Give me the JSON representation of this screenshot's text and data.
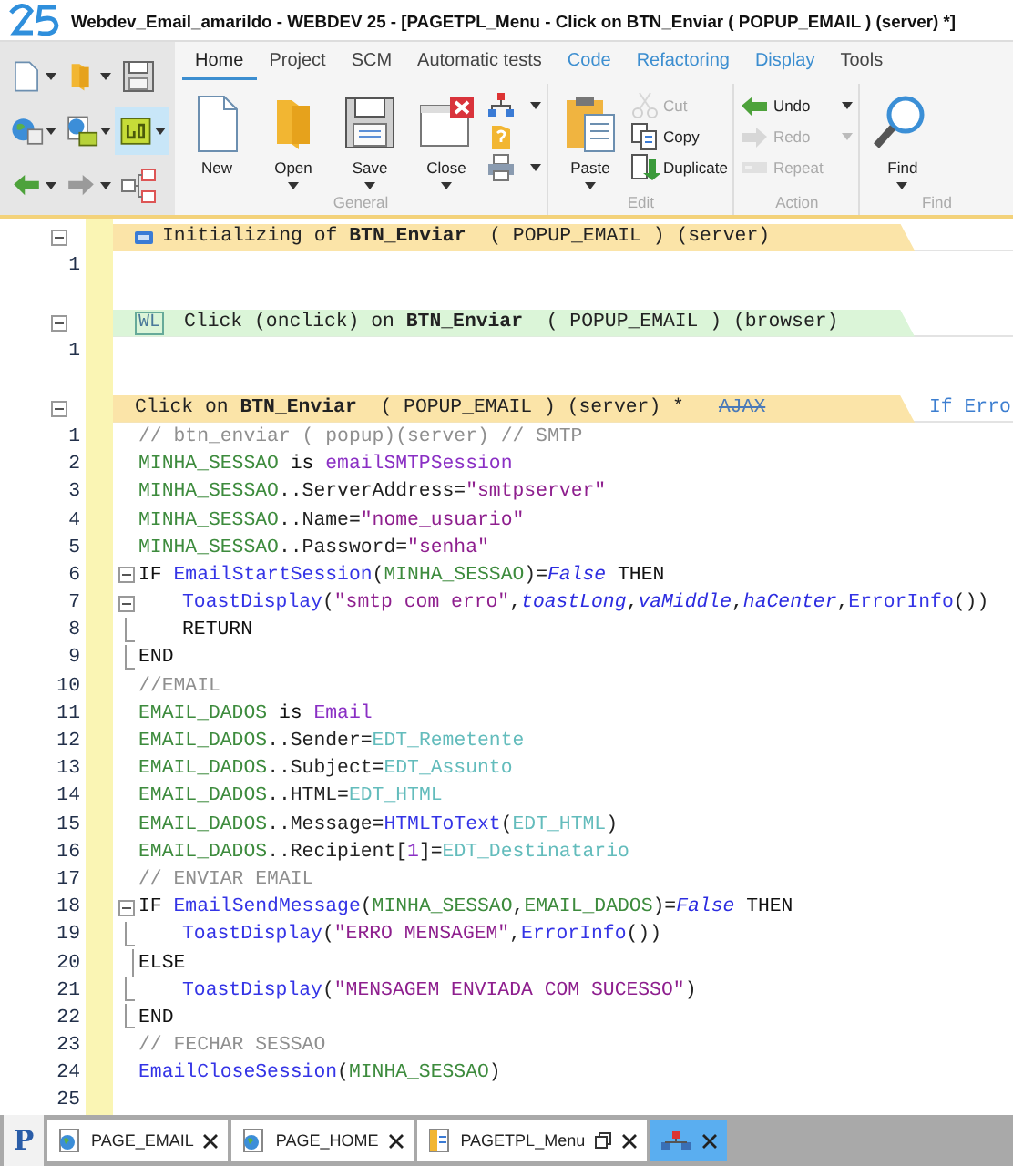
{
  "window": {
    "title": "Webdev_Email_amarildo - WEBDEV 25 - [PAGETPL_Menu - Click on BTN_Enviar ( POPUP_EMAIL ) (server) *]"
  },
  "quick_access": [
    {
      "dropdown": true,
      "highlighted": false
    },
    {
      "dropdown": true,
      "highlighted": false
    },
    {
      "dropdown": false,
      "highlighted": false
    },
    {
      "dropdown": true,
      "highlighted": false
    },
    {
      "dropdown": true,
      "highlighted": false
    },
    {
      "dropdown": true,
      "highlighted": true
    },
    {
      "dropdown": true,
      "highlighted": false
    },
    {
      "dropdown": true,
      "highlighted": false
    },
    {
      "dropdown": false,
      "highlighted": false
    }
  ],
  "ribbon": {
    "tabs": [
      {
        "label": "Home",
        "selected": true,
        "contextual": false
      },
      {
        "label": "Project",
        "selected": false,
        "contextual": false
      },
      {
        "label": "SCM",
        "selected": false,
        "contextual": false
      },
      {
        "label": "Automatic tests",
        "selected": false,
        "contextual": false
      },
      {
        "label": "Code",
        "selected": false,
        "contextual": true
      },
      {
        "label": "Refactoring",
        "selected": false,
        "contextual": true
      },
      {
        "label": "Display",
        "selected": false,
        "contextual": true
      },
      {
        "label": "Tools",
        "selected": false,
        "contextual": false
      }
    ],
    "groups": [
      {
        "label": "General",
        "buttons": [
          {
            "kind": "large",
            "label": "New",
            "disabled": false,
            "dropdown": false
          },
          {
            "kind": "large",
            "label": "Open",
            "disabled": false,
            "dropdown": true
          },
          {
            "kind": "large",
            "label": "Save",
            "disabled": false,
            "dropdown": true
          },
          {
            "kind": "large",
            "label": "Close",
            "disabled": false,
            "dropdown": true
          },
          {
            "kind": "small",
            "disabled": false,
            "dropdown": true
          },
          {
            "kind": "small",
            "disabled": false,
            "dropdown": false
          },
          {
            "kind": "small",
            "disabled": false,
            "dropdown": true
          }
        ]
      },
      {
        "label": "Edit",
        "buttons": [
          {
            "kind": "large",
            "label": "Paste",
            "disabled": false,
            "dropdown": true
          },
          {
            "kind": "small",
            "label": "Cut",
            "disabled": true,
            "dropdown": false
          },
          {
            "kind": "small",
            "label": "Copy",
            "disabled": false,
            "dropdown": false
          },
          {
            "kind": "small",
            "label": "Duplicate",
            "disabled": false,
            "dropdown": false
          }
        ]
      },
      {
        "label": "Action",
        "buttons": [
          {
            "kind": "small",
            "label": "Undo",
            "disabled": false,
            "dropdown": true
          },
          {
            "kind": "small",
            "label": "Redo",
            "disabled": true,
            "dropdown": true
          },
          {
            "kind": "small",
            "label": "Repeat",
            "disabled": true,
            "dropdown": false
          }
        ]
      },
      {
        "label": "Find",
        "buttons": [
          {
            "kind": "large",
            "label": "Find",
            "disabled": false,
            "dropdown": true
          }
        ]
      }
    ]
  },
  "editor": {
    "events": [
      {
        "kind": "init",
        "title": "Initializing of **BTN_Enviar**  ( POPUP_EMAIL ) (server)",
        "lines": [
          {
            "number": "1"
          }
        ]
      },
      {
        "kind": "browser",
        "badge": "WL",
        "title": "Click (onclick) on **BTN_Enviar**  ( POPUP_EMAIL ) (browser)",
        "lines": [
          {
            "number": "1"
          }
        ]
      },
      {
        "kind": "server",
        "title": "Click on **BTN_Enviar**  ( POPUP_EMAIL ) (server) *",
        "tag": "AJAX",
        "tag_enabled": false,
        "note": "If Erro",
        "lines": [
          {
            "number": "1",
            "kind": "plain",
            "nested": false,
            "tokens": [
              {
                "kind": "comment",
                "text": "// btn_enviar ( popup)(server) // SMTP"
              }
            ]
          },
          {
            "number": "2",
            "kind": "plain",
            "nested": false,
            "tokens": [
              {
                "kind": "variable",
                "text": "MINHA_SESSAO"
              },
              {
                "kind": "keyword",
                "text": " is "
              },
              {
                "kind": "type",
                "text": "emailSMTPSession"
              }
            ]
          },
          {
            "number": "3",
            "kind": "plain",
            "nested": false,
            "tokens": [
              {
                "kind": "variable",
                "text": "MINHA_SESSAO"
              },
              {
                "kind": "plain",
                "text": "..ServerAddress="
              },
              {
                "kind": "string",
                "text": "\"smtpserver\""
              }
            ]
          },
          {
            "number": "4",
            "kind": "plain",
            "nested": false,
            "tokens": [
              {
                "kind": "variable",
                "text": "MINHA_SESSAO"
              },
              {
                "kind": "plain",
                "text": "..Name="
              },
              {
                "kind": "string",
                "text": "\"nome_usuario\""
              }
            ]
          },
          {
            "number": "5",
            "kind": "plain",
            "nested": false,
            "tokens": [
              {
                "kind": "variable",
                "text": "MINHA_SESSAO"
              },
              {
                "kind": "plain",
                "text": "..Password="
              },
              {
                "kind": "string",
                "text": "\"senha\""
              }
            ]
          },
          {
            "number": "6",
            "kind": "fold_start",
            "nested": false,
            "tokens": [
              {
                "kind": "keyword",
                "text": "IF "
              },
              {
                "kind": "function",
                "text": "EmailStartSession"
              },
              {
                "kind": "plain",
                "text": "("
              },
              {
                "kind": "variable",
                "text": "MINHA_SESSAO"
              },
              {
                "kind": "plain",
                "text": ")="
              },
              {
                "kind": "constant",
                "text": "False"
              },
              {
                "kind": "keyword",
                "text": " THEN"
              }
            ]
          },
          {
            "number": "7",
            "kind": "fold_start",
            "nested": true,
            "tokens": [
              {
                "kind": "function",
                "text": "ToastDisplay"
              },
              {
                "kind": "plain",
                "text": "("
              },
              {
                "kind": "string",
                "text": "\"smtp com erro\""
              },
              {
                "kind": "plain",
                "text": ","
              },
              {
                "kind": "constant",
                "text": "toastLong"
              },
              {
                "kind": "plain",
                "text": ","
              },
              {
                "kind": "constant",
                "text": "vaMiddle"
              },
              {
                "kind": "plain",
                "text": ","
              },
              {
                "kind": "constant",
                "text": "haCenter"
              },
              {
                "kind": "plain",
                "text": ","
              },
              {
                "kind": "function",
                "text": "ErrorInfo"
              },
              {
                "kind": "plain",
                "text": "())"
              }
            ]
          },
          {
            "number": "8",
            "kind": "fold_end",
            "nested": true,
            "tokens": [
              {
                "kind": "keyword",
                "text": "RETURN"
              }
            ]
          },
          {
            "number": "9",
            "kind": "fold_end",
            "nested": false,
            "tokens": [
              {
                "kind": "keyword",
                "text": "END"
              }
            ]
          },
          {
            "number": "10",
            "kind": "plain",
            "nested": false,
            "tokens": [
              {
                "kind": "comment",
                "text": "//EMAIL"
              }
            ]
          },
          {
            "number": "11",
            "kind": "plain",
            "nested": false,
            "tokens": [
              {
                "kind": "variable",
                "text": "EMAIL_DADOS"
              },
              {
                "kind": "keyword",
                "text": " is "
              },
              {
                "kind": "type",
                "text": "Email"
              }
            ]
          },
          {
            "number": "12",
            "kind": "plain",
            "nested": false,
            "tokens": [
              {
                "kind": "variable",
                "text": "EMAIL_DADOS"
              },
              {
                "kind": "plain",
                "text": "..Sender="
              },
              {
                "kind": "control",
                "text": "EDT_Remetente"
              }
            ]
          },
          {
            "number": "13",
            "kind": "plain",
            "nested": false,
            "tokens": [
              {
                "kind": "variable",
                "text": "EMAIL_DADOS"
              },
              {
                "kind": "plain",
                "text": "..Subject="
              },
              {
                "kind": "control",
                "text": "EDT_Assunto"
              }
            ]
          },
          {
            "number": "14",
            "kind": "plain",
            "nested": false,
            "tokens": [
              {
                "kind": "variable",
                "text": "EMAIL_DADOS"
              },
              {
                "kind": "plain",
                "text": "..HTML="
              },
              {
                "kind": "control",
                "text": "EDT_HTML"
              }
            ]
          },
          {
            "number": "15",
            "kind": "plain",
            "nested": false,
            "tokens": [
              {
                "kind": "variable",
                "text": "EMAIL_DADOS"
              },
              {
                "kind": "plain",
                "text": "..Message="
              },
              {
                "kind": "function",
                "text": "HTMLToText"
              },
              {
                "kind": "plain",
                "text": "("
              },
              {
                "kind": "control",
                "text": "EDT_HTML"
              },
              {
                "kind": "plain",
                "text": ")"
              }
            ]
          },
          {
            "number": "16",
            "kind": "plain",
            "nested": false,
            "tokens": [
              {
                "kind": "variable",
                "text": "EMAIL_DADOS"
              },
              {
                "kind": "plain",
                "text": "..Recipient["
              },
              {
                "kind": "number",
                "text": "1"
              },
              {
                "kind": "plain",
                "text": "]="
              },
              {
                "kind": "control",
                "text": "EDT_Destinatario"
              }
            ]
          },
          {
            "number": "17",
            "kind": "plain",
            "nested": false,
            "tokens": [
              {
                "kind": "comment",
                "text": "// ENVIAR EMAIL"
              }
            ]
          },
          {
            "number": "18",
            "kind": "fold_start",
            "nested": false,
            "tokens": [
              {
                "kind": "keyword",
                "text": "IF "
              },
              {
                "kind": "function",
                "text": "EmailSendMessage"
              },
              {
                "kind": "plain",
                "text": "("
              },
              {
                "kind": "variable",
                "text": "MINHA_SESSAO"
              },
              {
                "kind": "plain",
                "text": ","
              },
              {
                "kind": "variable",
                "text": "EMAIL_DADOS"
              },
              {
                "kind": "plain",
                "text": ")="
              },
              {
                "kind": "constant",
                "text": "False"
              },
              {
                "kind": "keyword",
                "text": " THEN"
              }
            ]
          },
          {
            "number": "19",
            "kind": "fold_end",
            "nested": true,
            "tokens": [
              {
                "kind": "function",
                "text": "ToastDisplay"
              },
              {
                "kind": "plain",
                "text": "("
              },
              {
                "kind": "string",
                "text": "\"ERRO MENSAGEM\""
              },
              {
                "kind": "plain",
                "text": ","
              },
              {
                "kind": "function",
                "text": "ErrorInfo"
              },
              {
                "kind": "plain",
                "text": "())"
              }
            ]
          },
          {
            "number": "20",
            "kind": "fold_bar",
            "nested": false,
            "tokens": [
              {
                "kind": "keyword",
                "text": "ELSE"
              }
            ]
          },
          {
            "number": "21",
            "kind": "fold_end",
            "nested": true,
            "tokens": [
              {
                "kind": "function",
                "text": "ToastDisplay"
              },
              {
                "kind": "plain",
                "text": "("
              },
              {
                "kind": "string",
                "text": "\"MENSAGEM ENVIADA COM SUCESSO\""
              },
              {
                "kind": "plain",
                "text": ")"
              }
            ]
          },
          {
            "number": "22",
            "kind": "fold_end",
            "nested": false,
            "tokens": [
              {
                "kind": "keyword",
                "text": "END"
              }
            ]
          },
          {
            "number": "23",
            "kind": "plain",
            "nested": false,
            "tokens": [
              {
                "kind": "comment",
                "text": "// FECHAR SESSAO"
              }
            ]
          },
          {
            "number": "24",
            "kind": "plain",
            "nested": false,
            "tokens": [
              {
                "kind": "function",
                "text": "EmailCloseSession"
              },
              {
                "kind": "plain",
                "text": "("
              },
              {
                "kind": "variable",
                "text": "MINHA_SESSAO"
              },
              {
                "kind": "plain",
                "text": ")"
              }
            ]
          },
          {
            "number": "25"
          }
        ]
      }
    ]
  },
  "document_tabs": {
    "logo": "P",
    "tabs": [
      {
        "kind": "page",
        "label": "PAGE_EMAIL",
        "selected": false,
        "floating": false
      },
      {
        "kind": "page",
        "label": "PAGE_HOME",
        "selected": false,
        "floating": false
      },
      {
        "kind": "template",
        "label": "PAGETPL_Menu",
        "selected": false,
        "floating": true
      },
      {
        "kind": "diagram",
        "selected": true,
        "floating": false
      }
    ]
  }
}
